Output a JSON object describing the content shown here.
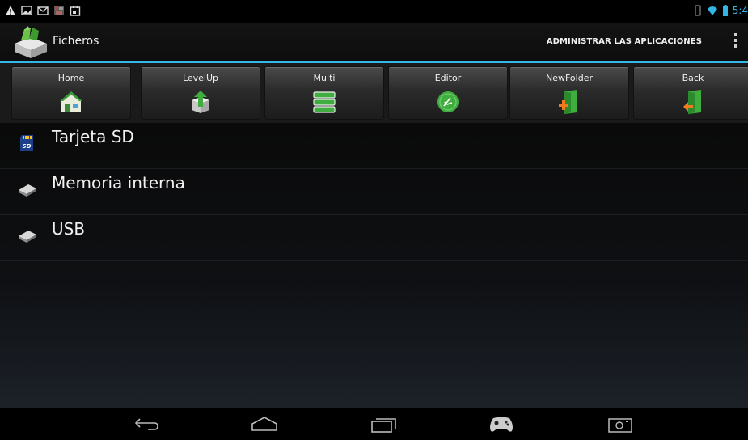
{
  "status_bar": {
    "time": "5:4",
    "icons": [
      "warning-icon",
      "image-icon",
      "mail-icon",
      "photo-icon",
      "calendar-icon",
      "vibrate-icon",
      "wifi-icon",
      "battery-icon"
    ]
  },
  "action_bar": {
    "title": "Ficheros",
    "action_label": "ADMINISTRAR LAS APLICACIONES",
    "overflow_icon": "overflow-menu-icon",
    "accent": "#33b5e5"
  },
  "toolbar": {
    "buttons": [
      {
        "label": "Home",
        "icon": "home-icon"
      },
      {
        "label": "LevelUp",
        "icon": "levelup-icon"
      },
      {
        "label": "Multi",
        "icon": "multi-select-icon"
      },
      {
        "label": "Editor",
        "icon": "editor-icon"
      },
      {
        "label": "NewFolder",
        "icon": "new-folder-icon"
      },
      {
        "label": "Back",
        "icon": "back-icon"
      }
    ]
  },
  "storage_list": {
    "items": [
      {
        "label": "Tarjeta SD",
        "icon": "sd-card-icon"
      },
      {
        "label": "Memoria interna",
        "icon": "drive-icon"
      },
      {
        "label": "USB",
        "icon": "drive-icon"
      }
    ]
  },
  "nav_bar": {
    "icons": [
      "back-nav-icon",
      "home-nav-icon",
      "recents-icon",
      "gamepad-icon",
      "screenshot-icon"
    ]
  }
}
